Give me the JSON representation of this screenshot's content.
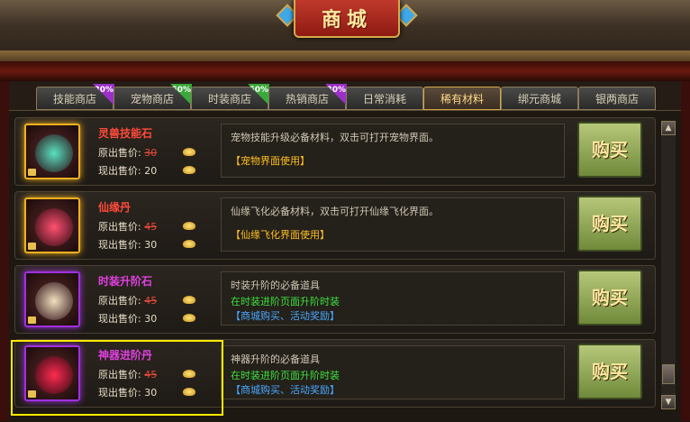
{
  "window": {
    "title": "商城"
  },
  "tabs": [
    {
      "label": "技能商店",
      "badge": "30%",
      "badge_color": "#9b30c8",
      "active": false
    },
    {
      "label": "宠物商店",
      "badge": "50%",
      "badge_color": "#3aa83a",
      "active": false
    },
    {
      "label": "时装商店",
      "badge": "50%",
      "badge_color": "#3aa83a",
      "active": false
    },
    {
      "label": "热销商店",
      "badge": "30%",
      "badge_color": "#9b30c8",
      "active": false
    },
    {
      "label": "日常消耗",
      "badge": "",
      "active": false
    },
    {
      "label": "稀有材料",
      "badge": "",
      "active": true
    },
    {
      "label": "绑元商城",
      "badge": "",
      "active": false
    },
    {
      "label": "银两商店",
      "badge": "",
      "active": false
    }
  ],
  "labels": {
    "orig_price": "原出售价:",
    "now_price": "现出售价:",
    "buy": "购买"
  },
  "items": [
    {
      "name": "灵兽技能石",
      "name_color": "#ff4a3a",
      "orig_price": "30",
      "now_price": "20",
      "desc": "宠物技能升级必备材料，双击可打开宠物界面。",
      "sub": "",
      "tag": "【宠物界面使用】",
      "tag_color": "#ffc020",
      "icon": "spirit-stone-icon",
      "rarity_color": "#f0b020"
    },
    {
      "name": "仙缘丹",
      "name_color": "#ff4a3a",
      "orig_price": "45",
      "now_price": "30",
      "desc": "仙缘飞化必备材料，双击可打开仙缘飞化界面。",
      "sub": "",
      "tag": "【仙缘飞化界面使用】",
      "tag_color": "#ffc020",
      "icon": "immortal-pill-icon",
      "rarity_color": "#f0b020"
    },
    {
      "name": "时装升阶石",
      "name_color": "#e040e0",
      "orig_price": "45",
      "now_price": "30",
      "desc": "时装升阶的必备道具",
      "sub": "在时装进阶页面升阶时装",
      "tag": "【商城购买、活动奖励】",
      "tag_color": "#4aa8ff",
      "icon": "fashion-stone-icon",
      "rarity_color": "#a030e0"
    },
    {
      "name": "神器进阶丹",
      "name_color": "#e040e0",
      "orig_price": "45",
      "now_price": "30",
      "desc": "神器升阶的必备道具",
      "sub": "在时装进阶页面升阶时装",
      "tag": "【商城购买、活动奖励】",
      "tag_color": "#4aa8ff",
      "icon": "artifact-pill-icon",
      "rarity_color": "#a030e0"
    }
  ]
}
